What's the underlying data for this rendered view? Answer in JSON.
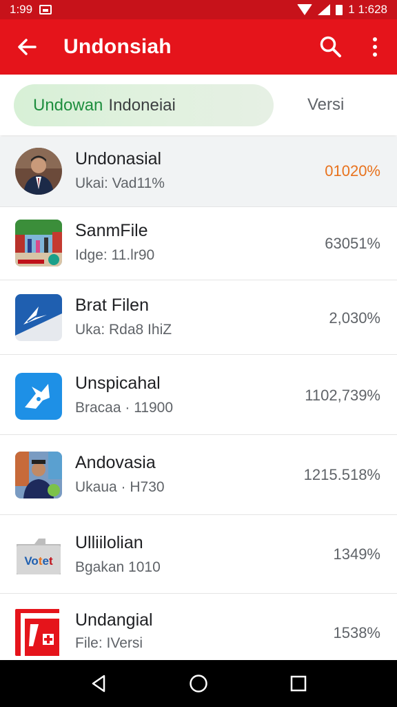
{
  "status_bar": {
    "time": "1:99",
    "right_text": "1 1:628"
  },
  "app_bar": {
    "title": "Undonsiah",
    "back_icon": "arrow-left-icon",
    "search_icon": "search-icon",
    "more_icon": "more-vert-icon",
    "background": "#e5141b"
  },
  "tabs": {
    "active": {
      "part1": "Undowan",
      "part2": "Indoneiai"
    },
    "versi": "Versi"
  },
  "list": {
    "items": [
      {
        "title": "Undonasial",
        "subtitle": "Ukai: Vad11%",
        "value": "01020%",
        "icon": "portrait-avatar-icon",
        "selected": true
      },
      {
        "title": "SanmFile",
        "subtitle": "Idge: 11.lr90",
        "value": "63051%",
        "icon": "photo-thumbnail-icon",
        "selected": false
      },
      {
        "title": "Brat Filen",
        "subtitle": "Uka: Rda8 IhiZ",
        "value": "2,030%",
        "icon": "blue-arrow-app-icon",
        "selected": false
      },
      {
        "title": "Unspicahal",
        "subtitle": "Bracaa · 11900",
        "value": "1102,739%",
        "icon": "blue-bird-app-icon",
        "selected": false
      },
      {
        "title": "Andovasia",
        "subtitle": "Ukaua · H730",
        "value": "1215.518%",
        "icon": "person-photo-icon",
        "selected": false
      },
      {
        "title": "Ulliilolian",
        "subtitle": "Bgakan 1010",
        "value": "1349%",
        "icon": "folder-vote-icon",
        "selected": false
      },
      {
        "title": "Undangial",
        "subtitle": "File: IVersi",
        "value": "1538%",
        "icon": "red-plus-app-icon",
        "selected": false
      }
    ]
  },
  "nav_bar": {
    "back_icon": "nav-back-icon",
    "home_icon": "nav-home-icon",
    "recents_icon": "nav-recents-icon"
  },
  "colors": {
    "accent_value": "#e8721d",
    "tab_green": "#1e8e3e"
  }
}
